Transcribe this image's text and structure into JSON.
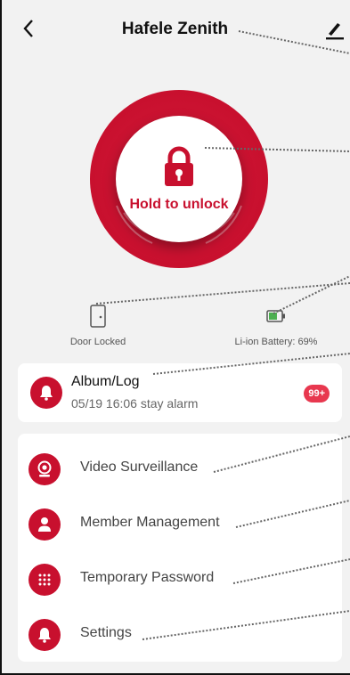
{
  "header": {
    "title": "Hafele Zenith",
    "back_icon": "chevron-left-icon",
    "edit_icon": "pencil-icon"
  },
  "lock": {
    "label": "Hold to unlock",
    "icon": "padlock-icon",
    "accent": "#c8102e"
  },
  "status": {
    "door_label": "Door Locked",
    "door_icon": "door-icon",
    "battery_label": "Li-ion Battery: 69%",
    "battery_icon": "battery-icon",
    "battery_level": 0.69
  },
  "album": {
    "title": "Album/Log",
    "subtitle": "05/19 16:06 stay alarm",
    "badge": "99+",
    "icon": "bell-icon"
  },
  "menu": [
    {
      "label": "Video Surveillance",
      "icon": "camera-icon"
    },
    {
      "label": "Member Management",
      "icon": "user-icon"
    },
    {
      "label": "Temporary Password",
      "icon": "keypad-icon"
    },
    {
      "label": "Settings",
      "icon": "bell-icon"
    }
  ]
}
